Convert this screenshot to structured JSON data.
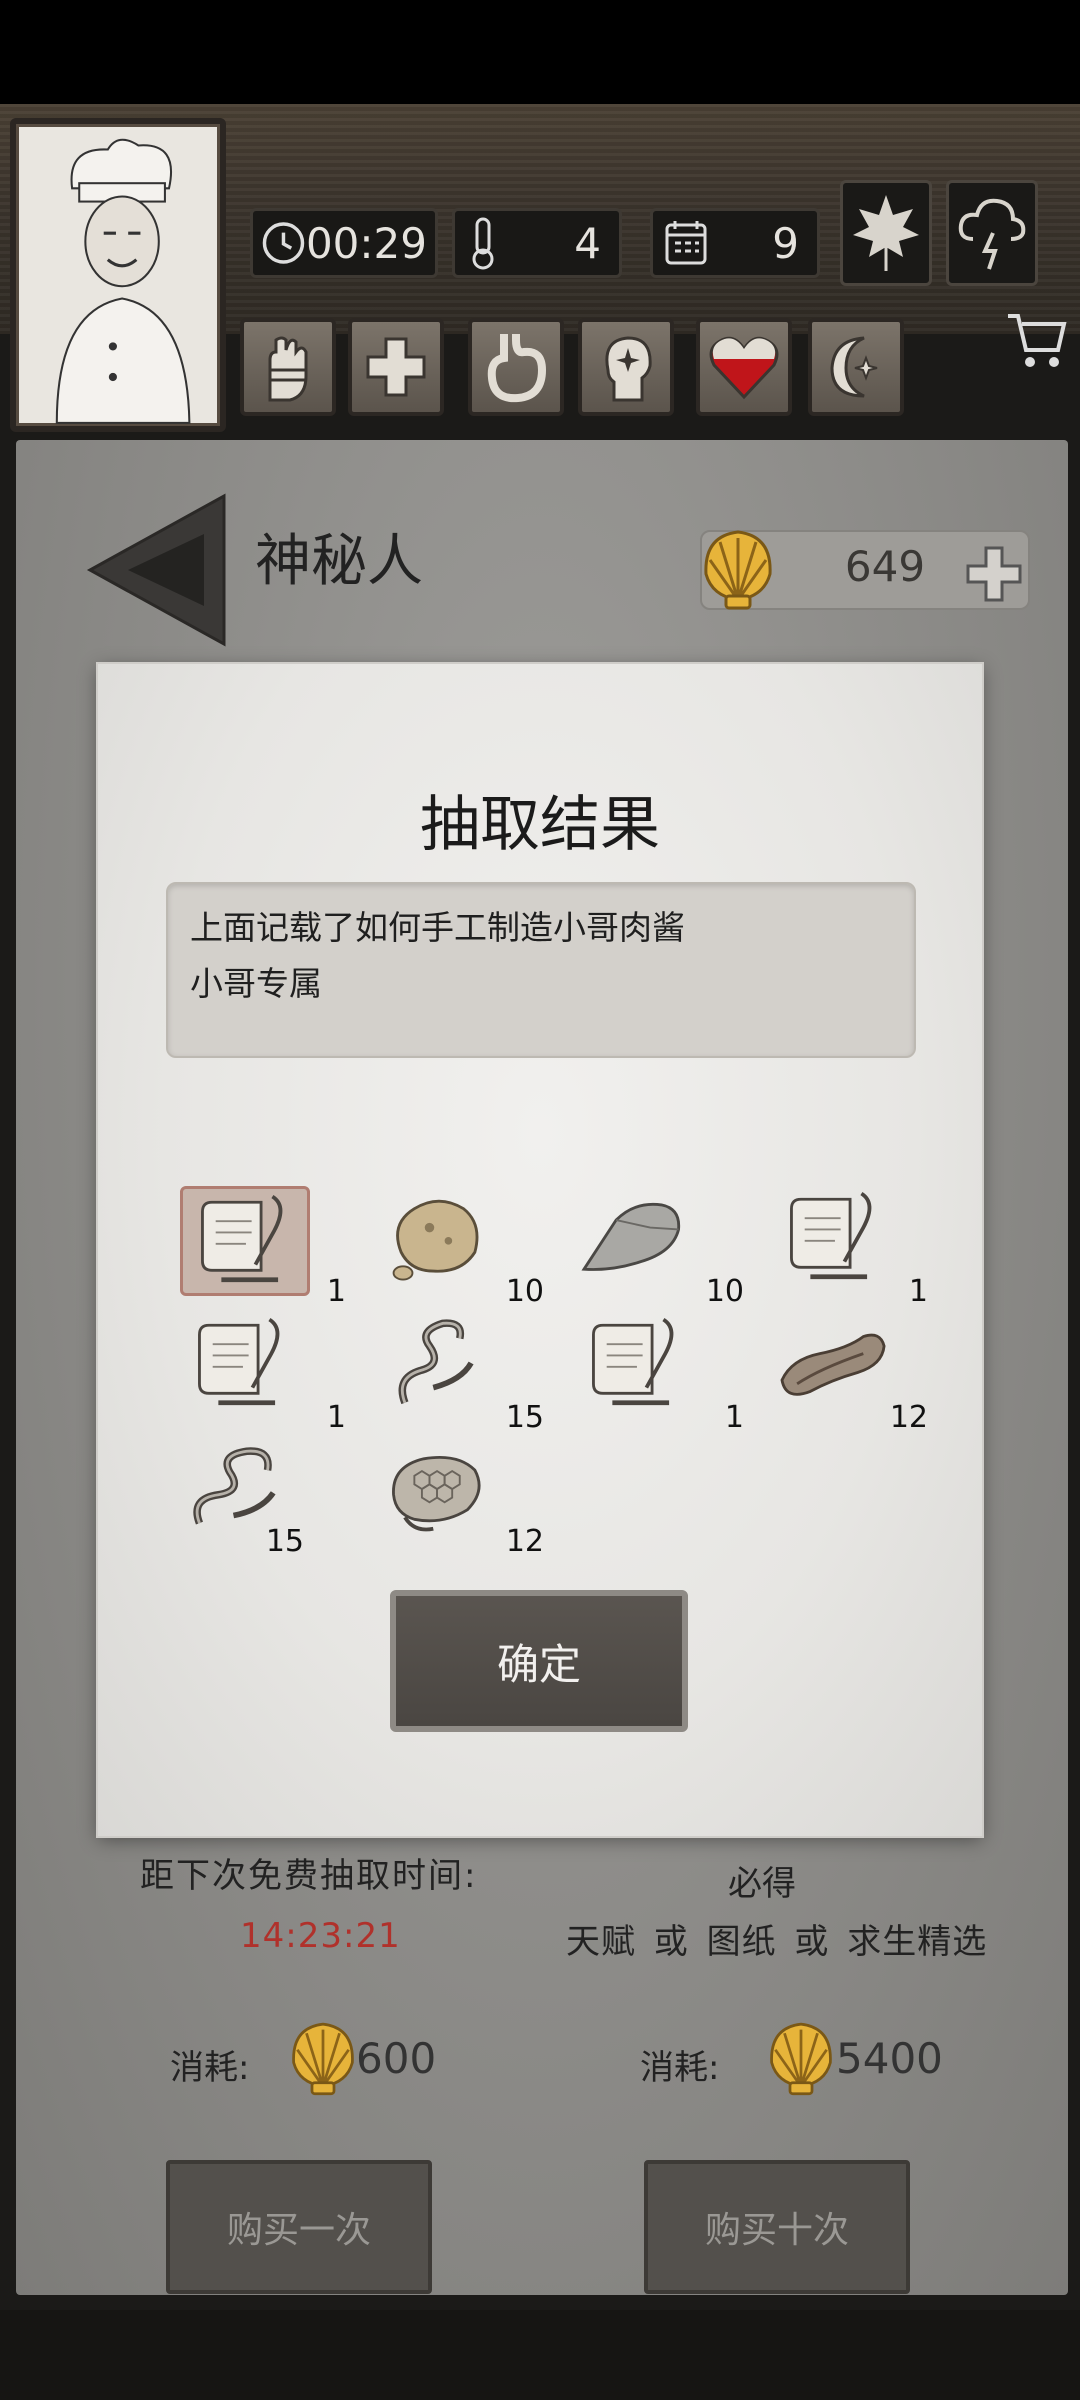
{
  "status": {
    "time": "00:29",
    "temperature": "4",
    "day": "9"
  },
  "header": {
    "title": "神秘人",
    "shells": "649"
  },
  "modal": {
    "title": "抽取结果",
    "description_line1": "上面记载了如何手工制造小哥肉酱",
    "description_line2": "小哥专属",
    "items": [
      {
        "icon": "scroll-quill-icon",
        "count": "1"
      },
      {
        "icon": "rock-icon",
        "count": "10"
      },
      {
        "icon": "flint-stone-icon",
        "count": "10"
      },
      {
        "icon": "scroll-quill-icon",
        "count": "1"
      },
      {
        "icon": "scroll-quill-icon",
        "count": "1"
      },
      {
        "icon": "vine-rope-icon",
        "count": "15"
      },
      {
        "icon": "scroll-quill-icon",
        "count": "1"
      },
      {
        "icon": "dried-meat-icon",
        "count": "12"
      },
      {
        "icon": "vine-rope-icon",
        "count": "15"
      },
      {
        "icon": "honeycomb-icon",
        "count": "12"
      }
    ],
    "confirm_label": "确定"
  },
  "gacha": {
    "free_label": "距下次免费抽取时间:",
    "timer": "14:23:21",
    "guarantee_label": "必得",
    "guarantee_items": "天赋 或 图纸 或 求生精选",
    "cost_label": "消耗:",
    "cost_single": "600",
    "cost_ten": "5400",
    "buy_single_label": "购买一次",
    "buy_ten_label": "购买十次"
  },
  "colors": {
    "timer_red": "#b0312b",
    "heart_red": "#c0151a"
  }
}
